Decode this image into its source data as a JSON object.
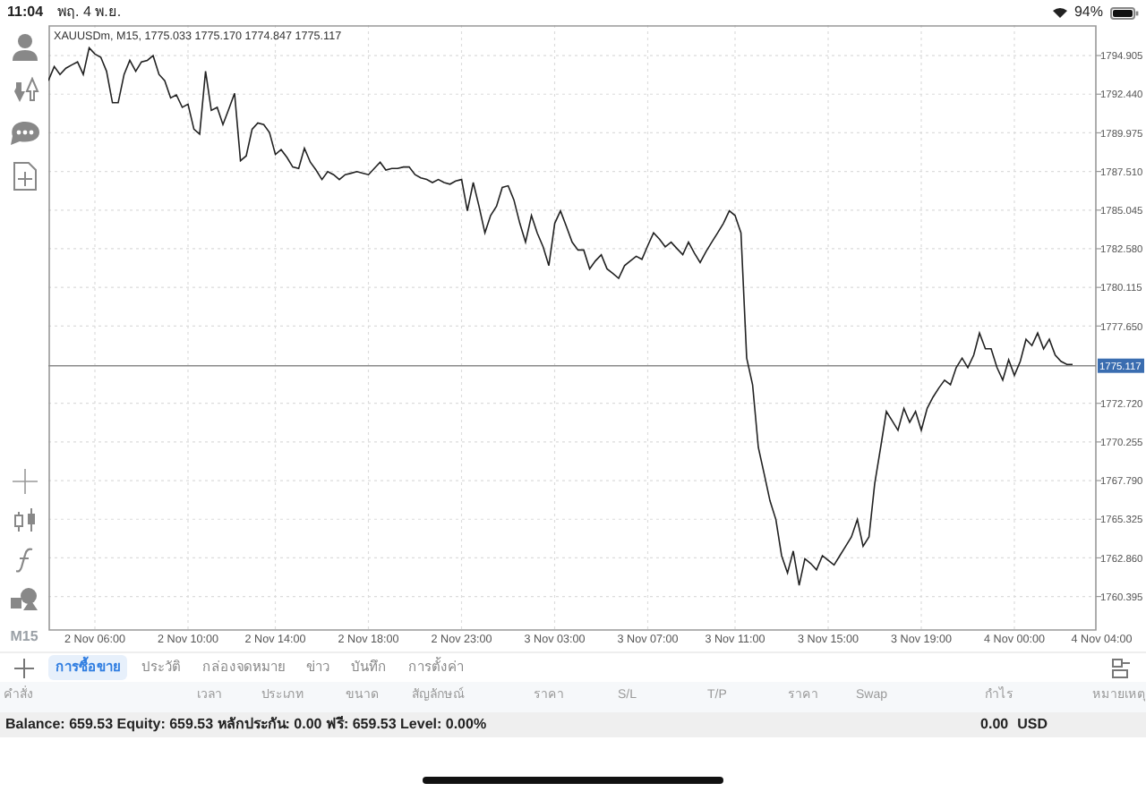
{
  "status_bar": {
    "time": "11:04",
    "date": "พฤ. 4 พ.ย.",
    "battery": "94%"
  },
  "toolbar": {
    "timeframe": "M15"
  },
  "chart": {
    "chart_data": {
      "type": "line",
      "title": "XAUUSDm, M15, 1775.033 1775.170 1774.847 1775.117",
      "ylim": [
        1758.26,
        1796.85
      ],
      "categories": [
        null,
        null,
        null,
        null,
        null,
        null,
        null,
        null,
        "2 Nov 06:00",
        null,
        null,
        null,
        null,
        null,
        null,
        null,
        null,
        null,
        null,
        null,
        null,
        null,
        null,
        null,
        "2 Nov 10:00",
        null,
        null,
        null,
        null,
        null,
        null,
        null,
        null,
        null,
        null,
        null,
        null,
        null,
        null,
        "2 Nov 14:00",
        null,
        null,
        null,
        null,
        null,
        null,
        null,
        null,
        null,
        null,
        null,
        null,
        null,
        null,
        null,
        "2 Nov 18:00",
        null,
        null,
        null,
        null,
        null,
        null,
        null,
        null,
        null,
        null,
        null,
        null,
        null,
        null,
        null,
        "2 Nov 23:00",
        null,
        null,
        null,
        null,
        null,
        null,
        null,
        null,
        null,
        null,
        null,
        null,
        null,
        null,
        null,
        "3 Nov 03:00",
        null,
        null,
        null,
        null,
        null,
        null,
        null,
        null,
        null,
        null,
        null,
        null,
        null,
        null,
        null,
        "3 Nov 07:00",
        null,
        null,
        null,
        null,
        null,
        null,
        null,
        null,
        null,
        null,
        null,
        null,
        null,
        null,
        "3 Nov 11:00",
        null,
        null,
        null,
        null,
        null,
        null,
        null,
        null,
        null,
        null,
        null,
        null,
        null,
        null,
        null,
        "3 Nov 15:00",
        null,
        null,
        null,
        null,
        null,
        null,
        null,
        null,
        null,
        null,
        null,
        null,
        null,
        null,
        null,
        "3 Nov 19:00",
        null,
        null,
        null,
        null,
        null,
        null,
        null,
        null,
        null,
        null,
        null,
        null,
        null,
        null,
        null,
        "4 Nov 00:00",
        null,
        null,
        null,
        null,
        null,
        null,
        null,
        null,
        null,
        null,
        null,
        null,
        null,
        null,
        "4 Nov 04:00"
      ],
      "yticks": [
        {
          "value": 1794.905,
          "label": "1794.905"
        },
        {
          "value": 1792.44,
          "label": "1792.440"
        },
        {
          "value": 1789.975,
          "label": "1789.975"
        },
        {
          "value": 1787.51,
          "label": "1787.510"
        },
        {
          "value": 1785.045,
          "label": "1785.045"
        },
        {
          "value": 1782.58,
          "label": "1782.580"
        },
        {
          "value": 1780.115,
          "label": "1780.115"
        },
        {
          "value": 1777.65,
          "label": "1777.650"
        },
        {
          "value": 1772.72,
          "label": "1772.720"
        },
        {
          "value": 1770.255,
          "label": "1770.255"
        },
        {
          "value": 1767.79,
          "label": "1767.790"
        },
        {
          "value": 1765.325,
          "label": "1765.325"
        },
        {
          "value": 1762.86,
          "label": "1762.860"
        },
        {
          "value": 1760.395,
          "label": "1760.395"
        }
      ],
      "series": [
        {
          "color": "#222222",
          "values": [
            1793.3,
            1794.2,
            1793.7,
            1794.1,
            1794.3,
            1794.5,
            1793.7,
            1795.4,
            1795.0,
            1794.8,
            1793.9,
            1791.9,
            1791.9,
            1793.7,
            1794.6,
            1793.9,
            1794.5,
            1794.6,
            1794.9,
            1793.7,
            1793.3,
            1792.2,
            1792.4,
            1791.6,
            1791.8,
            1790.2,
            1789.9,
            1793.9,
            1791.4,
            1791.6,
            1790.5,
            1791.5,
            1792.5,
            1788.2,
            1788.5,
            1790.2,
            1790.6,
            1790.5,
            1790.0,
            1788.6,
            1788.9,
            1788.4,
            1787.8,
            1787.7,
            1789.0,
            1788.1,
            1787.6,
            1787.0,
            1787.5,
            1787.3,
            1787.0,
            1787.3,
            1787.4,
            1787.5,
            1787.4,
            1787.3,
            1787.7,
            1788.1,
            1787.6,
            1787.7,
            1787.7,
            1787.8,
            1787.8,
            1787.3,
            1787.1,
            1787.0,
            1786.8,
            1787.0,
            1786.8,
            1786.7,
            1786.9,
            1787.0,
            1785.0,
            1786.8,
            1785.3,
            1783.6,
            1784.7,
            1785.3,
            1786.5,
            1786.6,
            1785.7,
            1784.2,
            1783.0,
            1784.7,
            1783.6,
            1782.7,
            1781.5,
            1784.2,
            1785.0,
            1784.0,
            1783.0,
            1782.5,
            1782.5,
            1781.3,
            1781.8,
            1782.2,
            1781.3,
            1781.0,
            1780.7,
            1781.5,
            1781.8,
            1782.1,
            1781.9,
            1782.8,
            1783.6,
            1783.2,
            1782.7,
            1783.0,
            1782.6,
            1782.2,
            1783.0,
            1782.3,
            1781.7,
            1782.4,
            1783.0,
            1783.6,
            1784.2,
            1785.0,
            1784.7,
            1783.6,
            1775.6,
            1773.9,
            1769.9,
            1768.2,
            1766.5,
            1765.3,
            1763.0,
            1761.9,
            1763.3,
            1761.1,
            1762.8,
            1762.5,
            1762.1,
            1763.0,
            1762.7,
            1762.4,
            1763.0,
            1763.6,
            1764.2,
            1765.3,
            1763.6,
            1764.2,
            1767.6,
            1769.9,
            1772.2,
            1771.6,
            1771.0,
            1772.4,
            1771.5,
            1772.2,
            1771.0,
            1772.4,
            1773.1,
            1773.7,
            1774.2,
            1773.9,
            1775.0,
            1775.6,
            1775.0,
            1775.8,
            1777.2,
            1776.2,
            1776.2,
            1775.0,
            1774.2,
            1775.5,
            1774.5,
            1775.4,
            1776.8,
            1776.4,
            1777.2,
            1776.2,
            1776.8,
            1775.8,
            1775.4,
            1775.2,
            1775.2,
            null,
            null,
            null,
            null,
            null
          ]
        }
      ],
      "grid": true,
      "ref_lines": [
        {
          "axis": "y",
          "value": 1775.117,
          "label": "1775.117"
        }
      ]
    }
  },
  "tabs": [
    {
      "label": "การซื้อขาย",
      "selected": true
    },
    {
      "label": "ประวัติ",
      "selected": false
    },
    {
      "label": "กล่องจดหมาย",
      "selected": false
    },
    {
      "label": "ข่าว",
      "selected": false
    },
    {
      "label": "บันทึก",
      "selected": false
    },
    {
      "label": "การตั้งค่า",
      "selected": false
    }
  ],
  "table": {
    "columns": [
      "คำสั่ง",
      "เวลา",
      "ประเภท",
      "ขนาด",
      "สัญลักษณ์",
      "ราคา",
      "S/L",
      "T/P",
      "ราคา",
      "Swap",
      "กำไร",
      "หมายเหตุ"
    ]
  },
  "summary": {
    "text": "Balance: 659.53 Equity: 659.53 หลักประกัน: 0.00 ฟรี: 659.53 Level: 0.00%",
    "profit": "0.00",
    "currency": "USD"
  }
}
